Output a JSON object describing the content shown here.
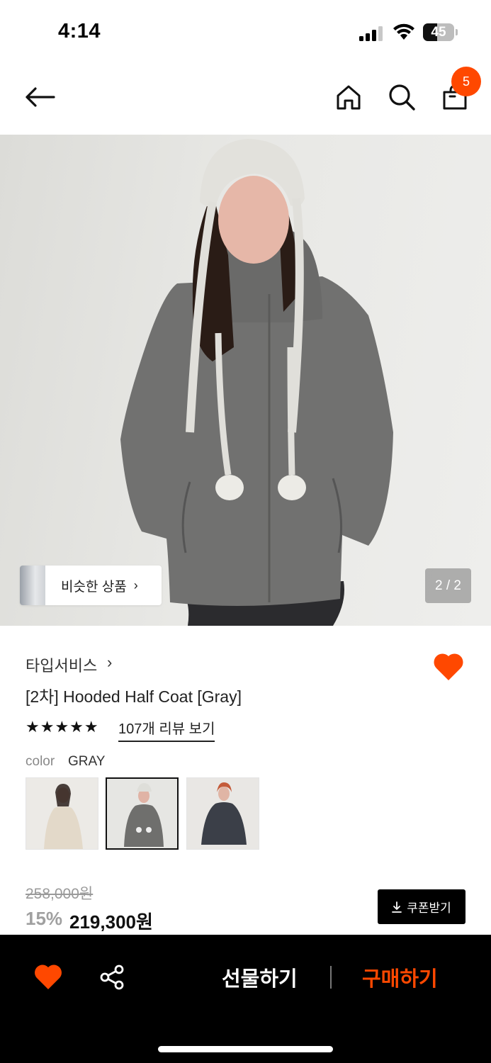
{
  "status_bar": {
    "time": "4:14",
    "battery": "45",
    "battery_level": 0.45
  },
  "nav": {
    "back_icon": "arrow-left-icon",
    "home_icon": "home-icon",
    "search_icon": "search-icon",
    "cart_icon": "shopping-bag-icon",
    "cart_count": "5"
  },
  "hero": {
    "similar_label": "비슷한 상품",
    "similar_chevron": "›",
    "page_indicator": "2 / 2"
  },
  "product": {
    "brand": "타입서비스",
    "brand_chevron": "›",
    "title": "[2차] Hooded Half Coat [Gray]",
    "stars": "★★★★★",
    "rating": 5,
    "review_link": "107개 리뷰 보기",
    "color_label": "color",
    "color_value": "GRAY",
    "wishlisted": true
  },
  "price": {
    "original": "258,000원",
    "discount": "15%",
    "sale": "219,300원",
    "coupon_label": "쿠폰받기",
    "coupon_icon": "download-icon"
  },
  "bottom_bar": {
    "heart_icon": "heart-icon",
    "share_icon": "share-icon",
    "gift_label": "선물하기",
    "buy_label": "구매하기"
  },
  "colors": {
    "accent": "#ff4800",
    "bottom_bar_bg": "#000000"
  }
}
